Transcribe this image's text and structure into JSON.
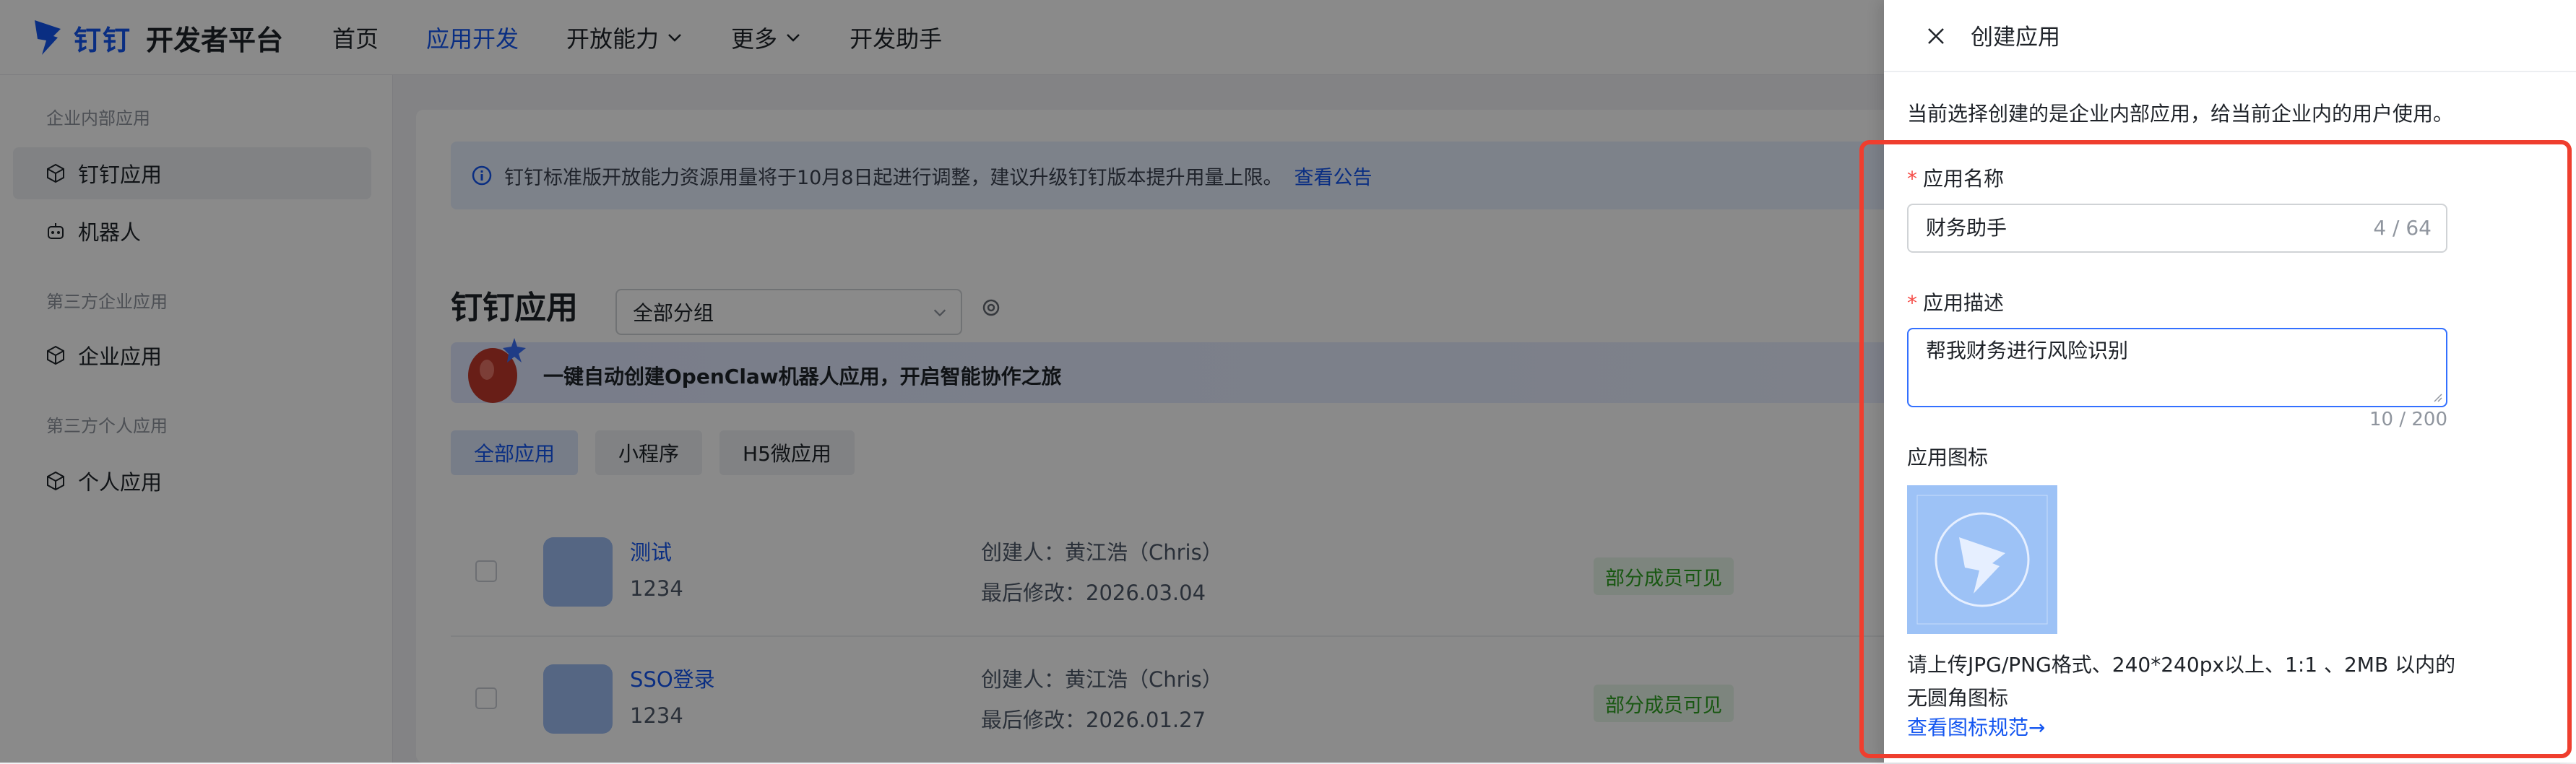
{
  "brand": {
    "name": "钉钉",
    "product": "开发者平台",
    "color": "#1456f0"
  },
  "nav": {
    "items": [
      "首页",
      "应用开发",
      "开放能力",
      "更多",
      "开发助手"
    ],
    "active_index": 1
  },
  "sidebar": {
    "sections": [
      {
        "title": "企业内部应用",
        "items": [
          {
            "label": "钉钉应用",
            "icon": "cube-icon"
          },
          {
            "label": "机器人",
            "icon": "robot-icon"
          }
        ]
      },
      {
        "title": "第三方企业应用",
        "items": [
          {
            "label": "企业应用",
            "icon": "cube-icon"
          }
        ]
      },
      {
        "title": "第三方个人应用",
        "items": [
          {
            "label": "个人应用",
            "icon": "cube-icon"
          }
        ]
      }
    ]
  },
  "main": {
    "notice": {
      "text": "钉钉标准版开放能力资源用量将于10月8日起进行调整，建议升级钉钉版本提升用量上限。",
      "link": "查看公告"
    },
    "title": "钉钉应用",
    "group_select": "全部分组",
    "banner": "一键自动创建OpenClaw机器人应用，开启智能协作之旅",
    "tabs": [
      "全部应用",
      "小程序",
      "H5微应用"
    ],
    "apps": [
      {
        "name": "测试",
        "id": "1234",
        "creator": "创建人：黄江浩（Chris）",
        "modified": "最后修改：2026.03.04",
        "visibility": "部分成员可见"
      },
      {
        "name": "SSO登录",
        "id": "1234",
        "creator": "创建人：黄江浩（Chris）",
        "modified": "最后修改：2026.01.27",
        "visibility": "部分成员可见"
      }
    ]
  },
  "drawer": {
    "title": "创建应用",
    "description": "当前选择创建的是企业内部应用，给当前企业内的用户使用。",
    "name_label": "应用名称",
    "name_value": "财务助手",
    "name_count": "4 / 64",
    "desc_label": "应用描述",
    "desc_value": "帮我财务进行风险识别",
    "desc_count": "10 / 200",
    "icon_label": "应用图标",
    "icon_hint": "请上传JPG/PNG格式、240*240px以上、1:1 、2MB 以内的无圆角图标",
    "icon_link": "查看图标规范→",
    "highlight_color": "#ef3e2e"
  }
}
